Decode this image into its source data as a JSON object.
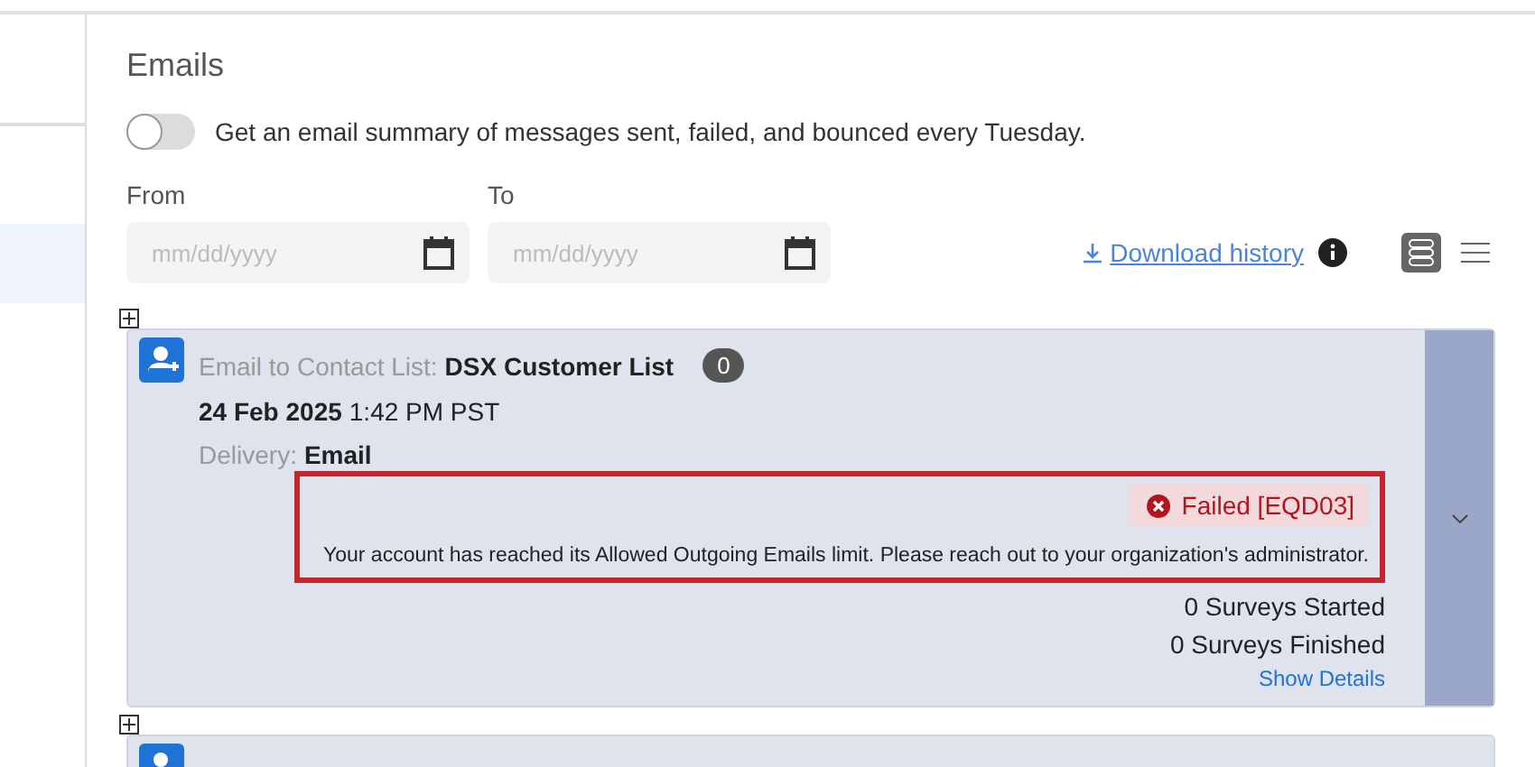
{
  "title": "Emails",
  "summary_toggle": {
    "label": "Get an email summary of messages sent, failed, and bounced every Tuesday.",
    "on": false
  },
  "date_fields": [
    {
      "label": "From",
      "placeholder": "mm/dd/yyyy"
    },
    {
      "label": "To",
      "placeholder": "mm/dd/yyyy"
    }
  ],
  "download_link": "Download history",
  "view_modes": [
    {
      "kind": "cards",
      "selected": true
    },
    {
      "kind": "list",
      "selected": false
    }
  ],
  "distributions": [
    {
      "heading_label": "Email to Contact List:",
      "list_name": "DSX Customer List",
      "count": "0",
      "date": "24 Feb 2025",
      "time": "1:42 PM PST",
      "delivery_label": "Delivery:",
      "delivery": "Email",
      "status": "Failed [EQD03]",
      "error_message": "Your account has reached its Allowed Outgoing Emails limit. Please reach out to your organization's administrator.",
      "started": "0 Surveys Started",
      "finished": "0 Surveys Finished",
      "details_link": "Show Details"
    }
  ]
}
